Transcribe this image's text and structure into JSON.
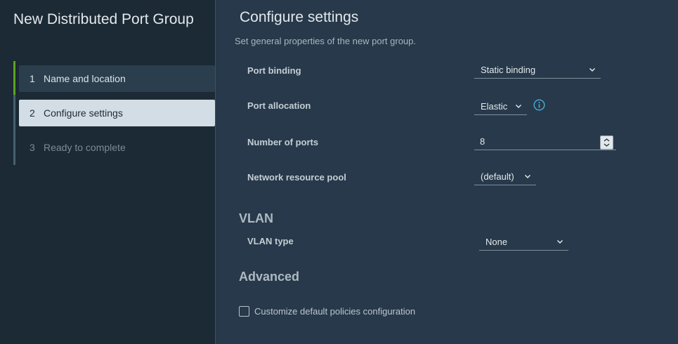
{
  "wizard": {
    "title": "New Distributed Port Group",
    "steps": [
      {
        "num": "1",
        "label": "Name and location"
      },
      {
        "num": "2",
        "label": "Configure settings"
      },
      {
        "num": "3",
        "label": "Ready to complete"
      }
    ]
  },
  "page": {
    "title": "Configure settings",
    "subtitle": "Set general properties of the new port group."
  },
  "fields": {
    "port_binding": {
      "label": "Port binding",
      "value": "Static binding"
    },
    "port_allocation": {
      "label": "Port allocation",
      "value": "Elastic"
    },
    "number_of_ports": {
      "label": "Number of ports",
      "value": "8"
    },
    "network_resource_pool": {
      "label": "Network resource pool",
      "value": "(default)"
    }
  },
  "vlan": {
    "heading": "VLAN",
    "type_label": "VLAN type",
    "type_value": "None"
  },
  "advanced": {
    "heading": "Advanced",
    "checkbox_label": "Customize default policies configuration",
    "checkbox_checked": false
  },
  "colors": {
    "accent_green": "#5aa220",
    "info_blue": "#49afd9",
    "sidebar_bg": "#1b2a35",
    "main_bg": "#27394a",
    "active_step_bg": "#d3dde5"
  },
  "icons": {
    "dropdown": "chevron-down-icon",
    "info": "info-circle-icon",
    "spinner": "spinner-arrows-icon"
  }
}
